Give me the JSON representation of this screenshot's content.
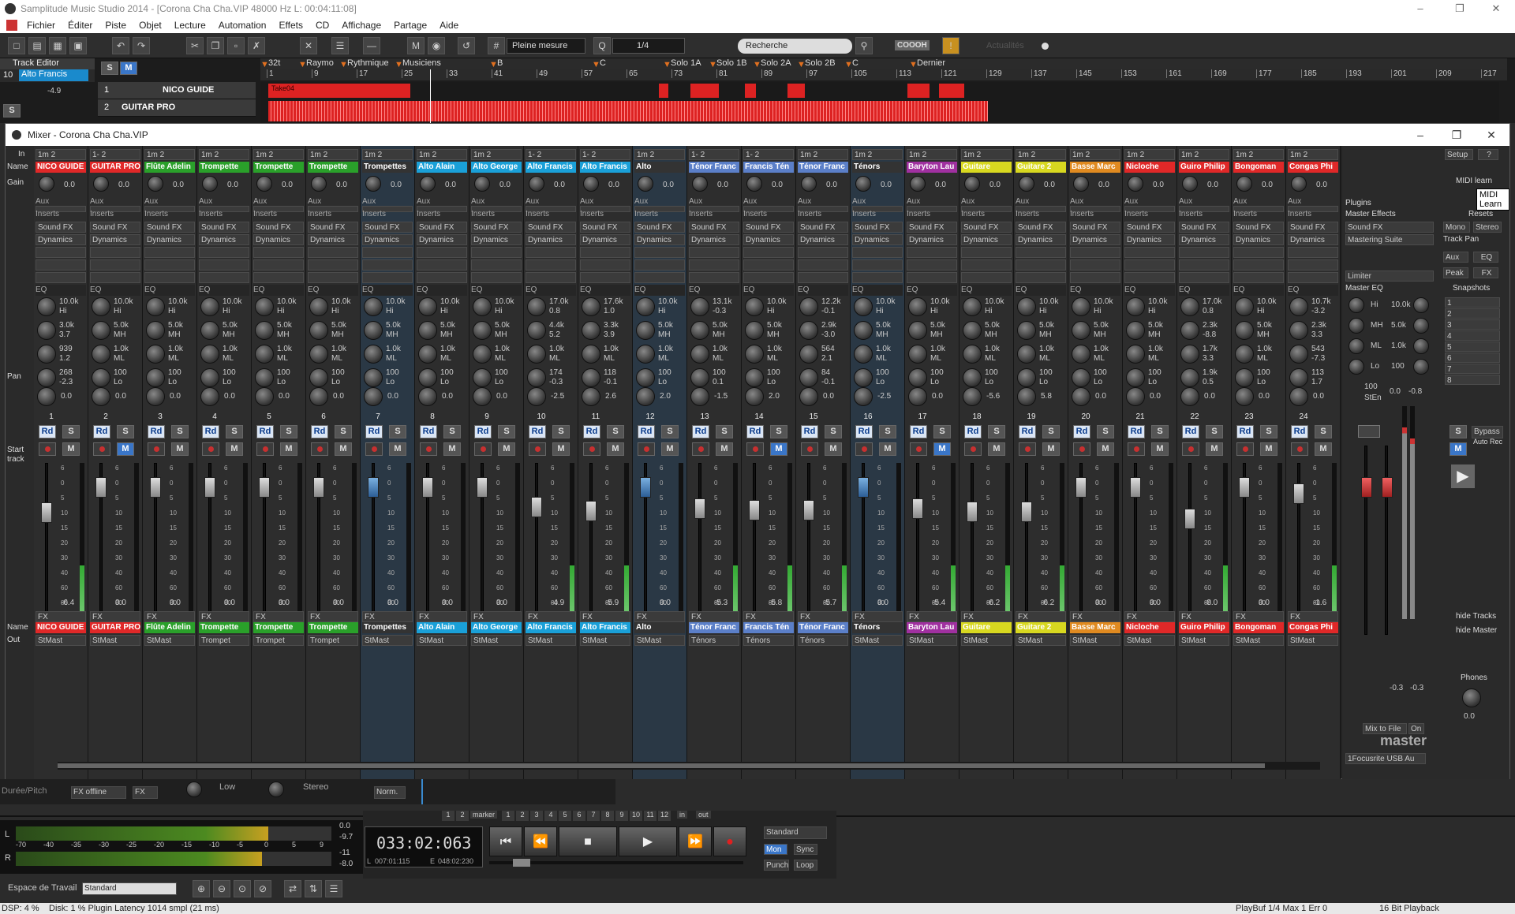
{
  "app": {
    "title": "Samplitude Music Studio 2014 - [Corona Cha Cha.VIP    48000 Hz L: 00:04:11:08]",
    "window_controls": [
      "–",
      "❐",
      "✕"
    ]
  },
  "menu": [
    "Fichier",
    "Éditer",
    "Piste",
    "Objet",
    "Lecture",
    "Automation",
    "Effets",
    "CD",
    "Affichage",
    "Partage",
    "Aide"
  ],
  "toolbar": {
    "grid_mode": "Pleine mesure",
    "quantize": "1/4",
    "search_placeholder": "Recherche",
    "news_label": "Actualités",
    "logo": "COOOH"
  },
  "track_editor": {
    "label": "Track Editor",
    "track_num": "10",
    "track_name": "Alto Francis",
    "s_btn": "S",
    "m_btn": "M",
    "vol": "-4.9",
    "tracks": [
      {
        "num": "1",
        "name": "NICO GUIDE"
      },
      {
        "num": "2",
        "name": "GUITAR PRO"
      }
    ],
    "clip_label": "Take04"
  },
  "ruler": {
    "bars": [
      "1",
      "9",
      "17",
      "25",
      "33",
      "41",
      "49",
      "57",
      "65",
      "73",
      "81",
      "89",
      "97",
      "105",
      "113",
      "121",
      "129",
      "137",
      "145",
      "153",
      "161",
      "169",
      "177",
      "185",
      "193",
      "201",
      "209",
      "217"
    ],
    "markers": [
      "32t",
      "Raymo",
      "Rythmique",
      "Musiciens",
      "B",
      "C",
      "Solo 1A",
      "Solo 1B",
      "Solo 2A",
      "Solo 2B",
      "C",
      "Dernier"
    ]
  },
  "mixer": {
    "title": "Mixer - Corona Cha Cha.VIP",
    "row_labels": {
      "in": "In",
      "name": "Name",
      "gain": "Gain",
      "aux": "Aux",
      "inserts": "Inserts",
      "eq": "EQ",
      "pan": "Pan",
      "start_track": "Start track",
      "out": "Out"
    },
    "sound_fx": "Sound FX",
    "dynamics": "Dynamics",
    "fx": "FX",
    "st_mast": "StMast",
    "channels": [
      {
        "num": "1",
        "name": "NICO GUIDE",
        "color": "#e02828",
        "input": "1m 2",
        "gain": "0.0",
        "eq": [
          "10.0k",
          "Hi",
          "3.0k",
          "3.7",
          "939",
          "1.2",
          "268",
          "-2.3"
        ],
        "pan": "0.0",
        "vol": "-6.4",
        "out": "StMast",
        "mute_on": false
      },
      {
        "num": "2",
        "name": "GUITAR PRO",
        "color": "#e02828",
        "input": "1- 2",
        "gain": "0.0",
        "eq": [
          "10.0k",
          "Hi",
          "5.0k",
          "MH",
          "1.0k",
          "ML",
          "100",
          "Lo"
        ],
        "pan": "0.0",
        "vol": "0.0",
        "out": "StMast",
        "mute_on": true
      },
      {
        "num": "3",
        "name": "Flûte Adelin",
        "color": "#2aa02a",
        "input": "1m 2",
        "gain": "0.0",
        "eq": [
          "10.0k",
          "Hi",
          "5.0k",
          "MH",
          "1.0k",
          "ML",
          "100",
          "Lo"
        ],
        "pan": "0.0",
        "vol": "0.0",
        "out": "StMast",
        "mute_on": false
      },
      {
        "num": "4",
        "name": "Trompette",
        "color": "#2aa02a",
        "input": "1m 2",
        "gain": "0.0",
        "eq": [
          "10.0k",
          "Hi",
          "5.0k",
          "MH",
          "1.0k",
          "ML",
          "100",
          "Lo"
        ],
        "pan": "0.0",
        "vol": "0.0",
        "out": "Trompet",
        "mute_on": false
      },
      {
        "num": "5",
        "name": "Trompette",
        "color": "#2aa02a",
        "input": "1m 2",
        "gain": "0.0",
        "eq": [
          "10.0k",
          "Hi",
          "5.0k",
          "MH",
          "1.0k",
          "ML",
          "100",
          "Lo"
        ],
        "pan": "0.0",
        "vol": "0.0",
        "out": "Trompet",
        "mute_on": false
      },
      {
        "num": "6",
        "name": "Trompette",
        "color": "#2aa02a",
        "input": "1m 2",
        "gain": "0.0",
        "eq": [
          "10.0k",
          "Hi",
          "5.0k",
          "MH",
          "1.0k",
          "ML",
          "100",
          "Lo"
        ],
        "pan": "0.0",
        "vol": "0.0",
        "out": "Trompet",
        "mute_on": false
      },
      {
        "num": "7",
        "name": "Trompettes",
        "color": "#333333",
        "input": "1m 2",
        "gain": "0.0",
        "eq": [
          "10.0k",
          "Hi",
          "5.0k",
          "MH",
          "1.0k",
          "ML",
          "100",
          "Lo"
        ],
        "pan": "0.0",
        "vol": "0.0",
        "out": "StMast",
        "mute_on": false,
        "selected": true
      },
      {
        "num": "8",
        "name": "Alto Alain",
        "color": "#1aa0d8",
        "input": "1m 2",
        "gain": "0.0",
        "eq": [
          "10.0k",
          "Hi",
          "5.0k",
          "MH",
          "1.0k",
          "ML",
          "100",
          "Lo"
        ],
        "pan": "0.0",
        "vol": "0.0",
        "out": "StMast",
        "mute_on": false
      },
      {
        "num": "9",
        "name": "Alto George",
        "color": "#1aa0d8",
        "input": "1m 2",
        "gain": "0.0",
        "eq": [
          "10.0k",
          "Hi",
          "5.0k",
          "MH",
          "1.0k",
          "ML",
          "100",
          "Lo"
        ],
        "pan": "0.0",
        "vol": "0.0",
        "out": "StMast",
        "mute_on": false
      },
      {
        "num": "10",
        "name": "Alto Francis",
        "color": "#1aa0d8",
        "input": "1- 2",
        "gain": "0.0",
        "eq": [
          "17.0k",
          "0.8",
          "4.4k",
          "5.2",
          "1.0k",
          "ML",
          "174",
          "-0.3"
        ],
        "pan": "-2.5",
        "vol": "-4.9",
        "out": "StMast",
        "mute_on": false
      },
      {
        "num": "11",
        "name": "Alto Francis",
        "color": "#1aa0d8",
        "input": "1- 2",
        "gain": "0.0",
        "eq": [
          "17.6k",
          "1.0",
          "3.3k",
          "3.9",
          "1.0k",
          "ML",
          "118",
          "-0.1"
        ],
        "pan": "2.6",
        "vol": "-5.9",
        "out": "StMast",
        "mute_on": false
      },
      {
        "num": "12",
        "name": "Alto",
        "color": "#333333",
        "input": "1m 2",
        "gain": "0.0",
        "eq": [
          "10.0k",
          "Hi",
          "5.0k",
          "MH",
          "1.0k",
          "ML",
          "100",
          "Lo"
        ],
        "pan": "2.0",
        "vol": "0.0",
        "out": "StMast",
        "mute_on": false,
        "selected": true
      },
      {
        "num": "13",
        "name": "Ténor Franc",
        "color": "#5b7fc8",
        "input": "1- 2",
        "gain": "0.0",
        "eq": [
          "13.1k",
          "-0.3",
          "5.0k",
          "MH",
          "1.0k",
          "ML",
          "100",
          "0.1"
        ],
        "pan": "-1.5",
        "vol": "-5.3",
        "out": "Ténors",
        "mute_on": false
      },
      {
        "num": "14",
        "name": "Francis Tén",
        "color": "#5b7fc8",
        "input": "1- 2",
        "gain": "0.0",
        "eq": [
          "10.0k",
          "Hi",
          "5.0k",
          "MH",
          "1.0k",
          "ML",
          "100",
          "Lo"
        ],
        "pan": "2.0",
        "vol": "-5.8",
        "out": "Ténors",
        "mute_on": true
      },
      {
        "num": "15",
        "name": "Ténor Franc",
        "color": "#5b7fc8",
        "input": "1m 2",
        "gain": "0.0",
        "eq": [
          "12.2k",
          "-0.1",
          "2.9k",
          "-3.0",
          "564",
          "2.1",
          "84",
          "-0.1"
        ],
        "pan": "0.0",
        "vol": "-5.7",
        "out": "Ténors",
        "mute_on": false
      },
      {
        "num": "16",
        "name": "Ténors",
        "color": "#333333",
        "input": "1m 2",
        "gain": "0.0",
        "eq": [
          "10.0k",
          "Hi",
          "5.0k",
          "MH",
          "1.0k",
          "ML",
          "100",
          "Lo"
        ],
        "pan": "-2.5",
        "vol": "0.0",
        "out": "StMast",
        "mute_on": false,
        "selected": true
      },
      {
        "num": "17",
        "name": "Baryton Lau",
        "color": "#a030a0",
        "input": "1m 2",
        "gain": "0.0",
        "eq": [
          "10.0k",
          "Hi",
          "5.0k",
          "MH",
          "1.0k",
          "ML",
          "100",
          "Lo"
        ],
        "pan": "0.0",
        "vol": "-5.4",
        "out": "StMast",
        "mute_on": true
      },
      {
        "num": "18",
        "name": "Guitare",
        "color": "#d8d820",
        "input": "1m 2",
        "gain": "0.0",
        "eq": [
          "10.0k",
          "Hi",
          "5.0k",
          "MH",
          "1.0k",
          "ML",
          "100",
          "Lo"
        ],
        "pan": "-5.6",
        "vol": "-6.2",
        "out": "StMast",
        "mute_on": false
      },
      {
        "num": "19",
        "name": "Guitare 2",
        "color": "#d8d820",
        "input": "1m 2",
        "gain": "0.0",
        "eq": [
          "10.0k",
          "Hi",
          "5.0k",
          "MH",
          "1.0k",
          "ML",
          "100",
          "Lo"
        ],
        "pan": "5.8",
        "vol": "-6.2",
        "out": "StMast",
        "mute_on": false
      },
      {
        "num": "20",
        "name": "Basse Marc",
        "color": "#e08a20",
        "input": "1m 2",
        "gain": "0.0",
        "eq": [
          "10.0k",
          "Hi",
          "5.0k",
          "MH",
          "1.0k",
          "ML",
          "100",
          "Lo"
        ],
        "pan": "0.0",
        "vol": "0.0",
        "out": "StMast",
        "mute_on": false
      },
      {
        "num": "21",
        "name": "Nicloche",
        "color": "#e02828",
        "input": "1m 2",
        "gain": "0.0",
        "eq": [
          "10.0k",
          "Hi",
          "5.0k",
          "MH",
          "1.0k",
          "ML",
          "100",
          "Lo"
        ],
        "pan": "0.0",
        "vol": "0.0",
        "out": "StMast",
        "mute_on": false
      },
      {
        "num": "22",
        "name": "Guiro Philip",
        "color": "#e02828",
        "input": "1m 2",
        "gain": "0.0",
        "eq": [
          "17.0k",
          "0.8",
          "2.3k",
          "-8.8",
          "1.7k",
          "3.3",
          "1.9k",
          "0.5"
        ],
        "pan": "0.0",
        "vol": "-8.0",
        "out": "StMast",
        "mute_on": false
      },
      {
        "num": "23",
        "name": "Bongoman",
        "color": "#e02828",
        "input": "1m 2",
        "gain": "0.0",
        "eq": [
          "10.0k",
          "Hi",
          "5.0k",
          "MH",
          "1.0k",
          "ML",
          "100",
          "Lo"
        ],
        "pan": "0.0",
        "vol": "0.0",
        "out": "StMast",
        "mute_on": false
      },
      {
        "num": "24",
        "name": "Congas Phi",
        "color": "#e02828",
        "input": "1m 2",
        "gain": "0.0",
        "eq": [
          "10.7k",
          "-3.2",
          "2.3k",
          "3.3",
          "543",
          "-7.3",
          "113",
          "1.7"
        ],
        "pan": "0.0",
        "vol": "-1.6",
        "out": "StMast",
        "mute_on": false
      }
    ],
    "fader_scale": [
      "6",
      "0",
      "5",
      "10",
      "15",
      "20",
      "30",
      "40",
      "60",
      "80"
    ],
    "right": {
      "setup": "Setup",
      "help": "?",
      "midi_learn": "MIDI learn",
      "midi_learn_tooltip": "MIDI Learn",
      "plugins": "Plugins",
      "master_effects": "Master Effects",
      "resets": "Resets",
      "sound_fx": "Sound FX",
      "mastering_suite": "Mastering Suite",
      "mono": "Mono",
      "stereo": "Stereo",
      "track_pan": "Track Pan",
      "aux": "Aux",
      "eq": "EQ",
      "peak": "Peak",
      "fx": "FX",
      "limiter": "Limiter",
      "master_eq": "Master EQ",
      "snapshots": "Snapshots",
      "snapshot_nums": [
        "1",
        "2",
        "3",
        "4",
        "5",
        "6",
        "7",
        "8"
      ],
      "meq": [
        {
          "band": "Hi",
          "freq": "10.0k"
        },
        {
          "band": "MH",
          "freq": "5.0k"
        },
        {
          "band": "ML",
          "freq": "1.0k"
        },
        {
          "band": "Lo",
          "freq": "100"
        }
      ],
      "master_width": "100",
      "stereo_label": "StEn",
      "master_peak_l": "0.0",
      "master_peak_r": "-0.8",
      "master_out_l": "-0.3",
      "master_out_r": "-0.3",
      "s_btn": "S",
      "bypass": "Bypass",
      "m_btn": "M",
      "auto_rec": "Auto Rec",
      "hide_tracks": "hide Tracks",
      "hide_master": "hide Master",
      "phones": "Phones",
      "phones_val": "0.0",
      "mix_to_file": "Mix to File",
      "on": "On",
      "master_name": "master",
      "out_device": "1Focusrite USB Au"
    }
  },
  "lower": {
    "duration_label": "Durée/Pitch",
    "fx_offline": "FX offline",
    "fx": "FX",
    "low": "Low",
    "stereo": "Stereo",
    "norm": "Norm."
  },
  "transport": {
    "marker_label": "marker",
    "nums": [
      "1",
      "2",
      "1",
      "2",
      "3",
      "4",
      "5",
      "6",
      "7",
      "8",
      "9",
      "10",
      "11",
      "12"
    ],
    "in": "in",
    "out": "out",
    "time": "033:02:063",
    "l_label": "L",
    "l_pos": "007:01:115",
    "e_label": "E",
    "e_pos": "048:02:230",
    "mode": "Standard",
    "mon": "Mon",
    "sync": "Sync",
    "punch": "Punch",
    "loop": "Loop",
    "meter_scale": [
      "-70",
      "-40",
      "-35",
      "-30",
      "-25",
      "-20",
      "-15",
      "-10",
      "-5",
      "0",
      "5",
      "9"
    ],
    "meter_vals": [
      "0.0",
      "-9.7",
      "-11",
      "-8.0"
    ],
    "meter_l": "L",
    "meter_r": "R"
  },
  "workspace": {
    "label": "Espace de Travail",
    "value": "Standard"
  },
  "status": {
    "dsp": "DSP: 4 %",
    "disk": "Disk:  1 %  Plugin Latency 1014 smpl (21 ms)",
    "playbuf": "PlayBuf 1/4  Max 1  Err 0",
    "bits": "16 Bit Playback"
  }
}
